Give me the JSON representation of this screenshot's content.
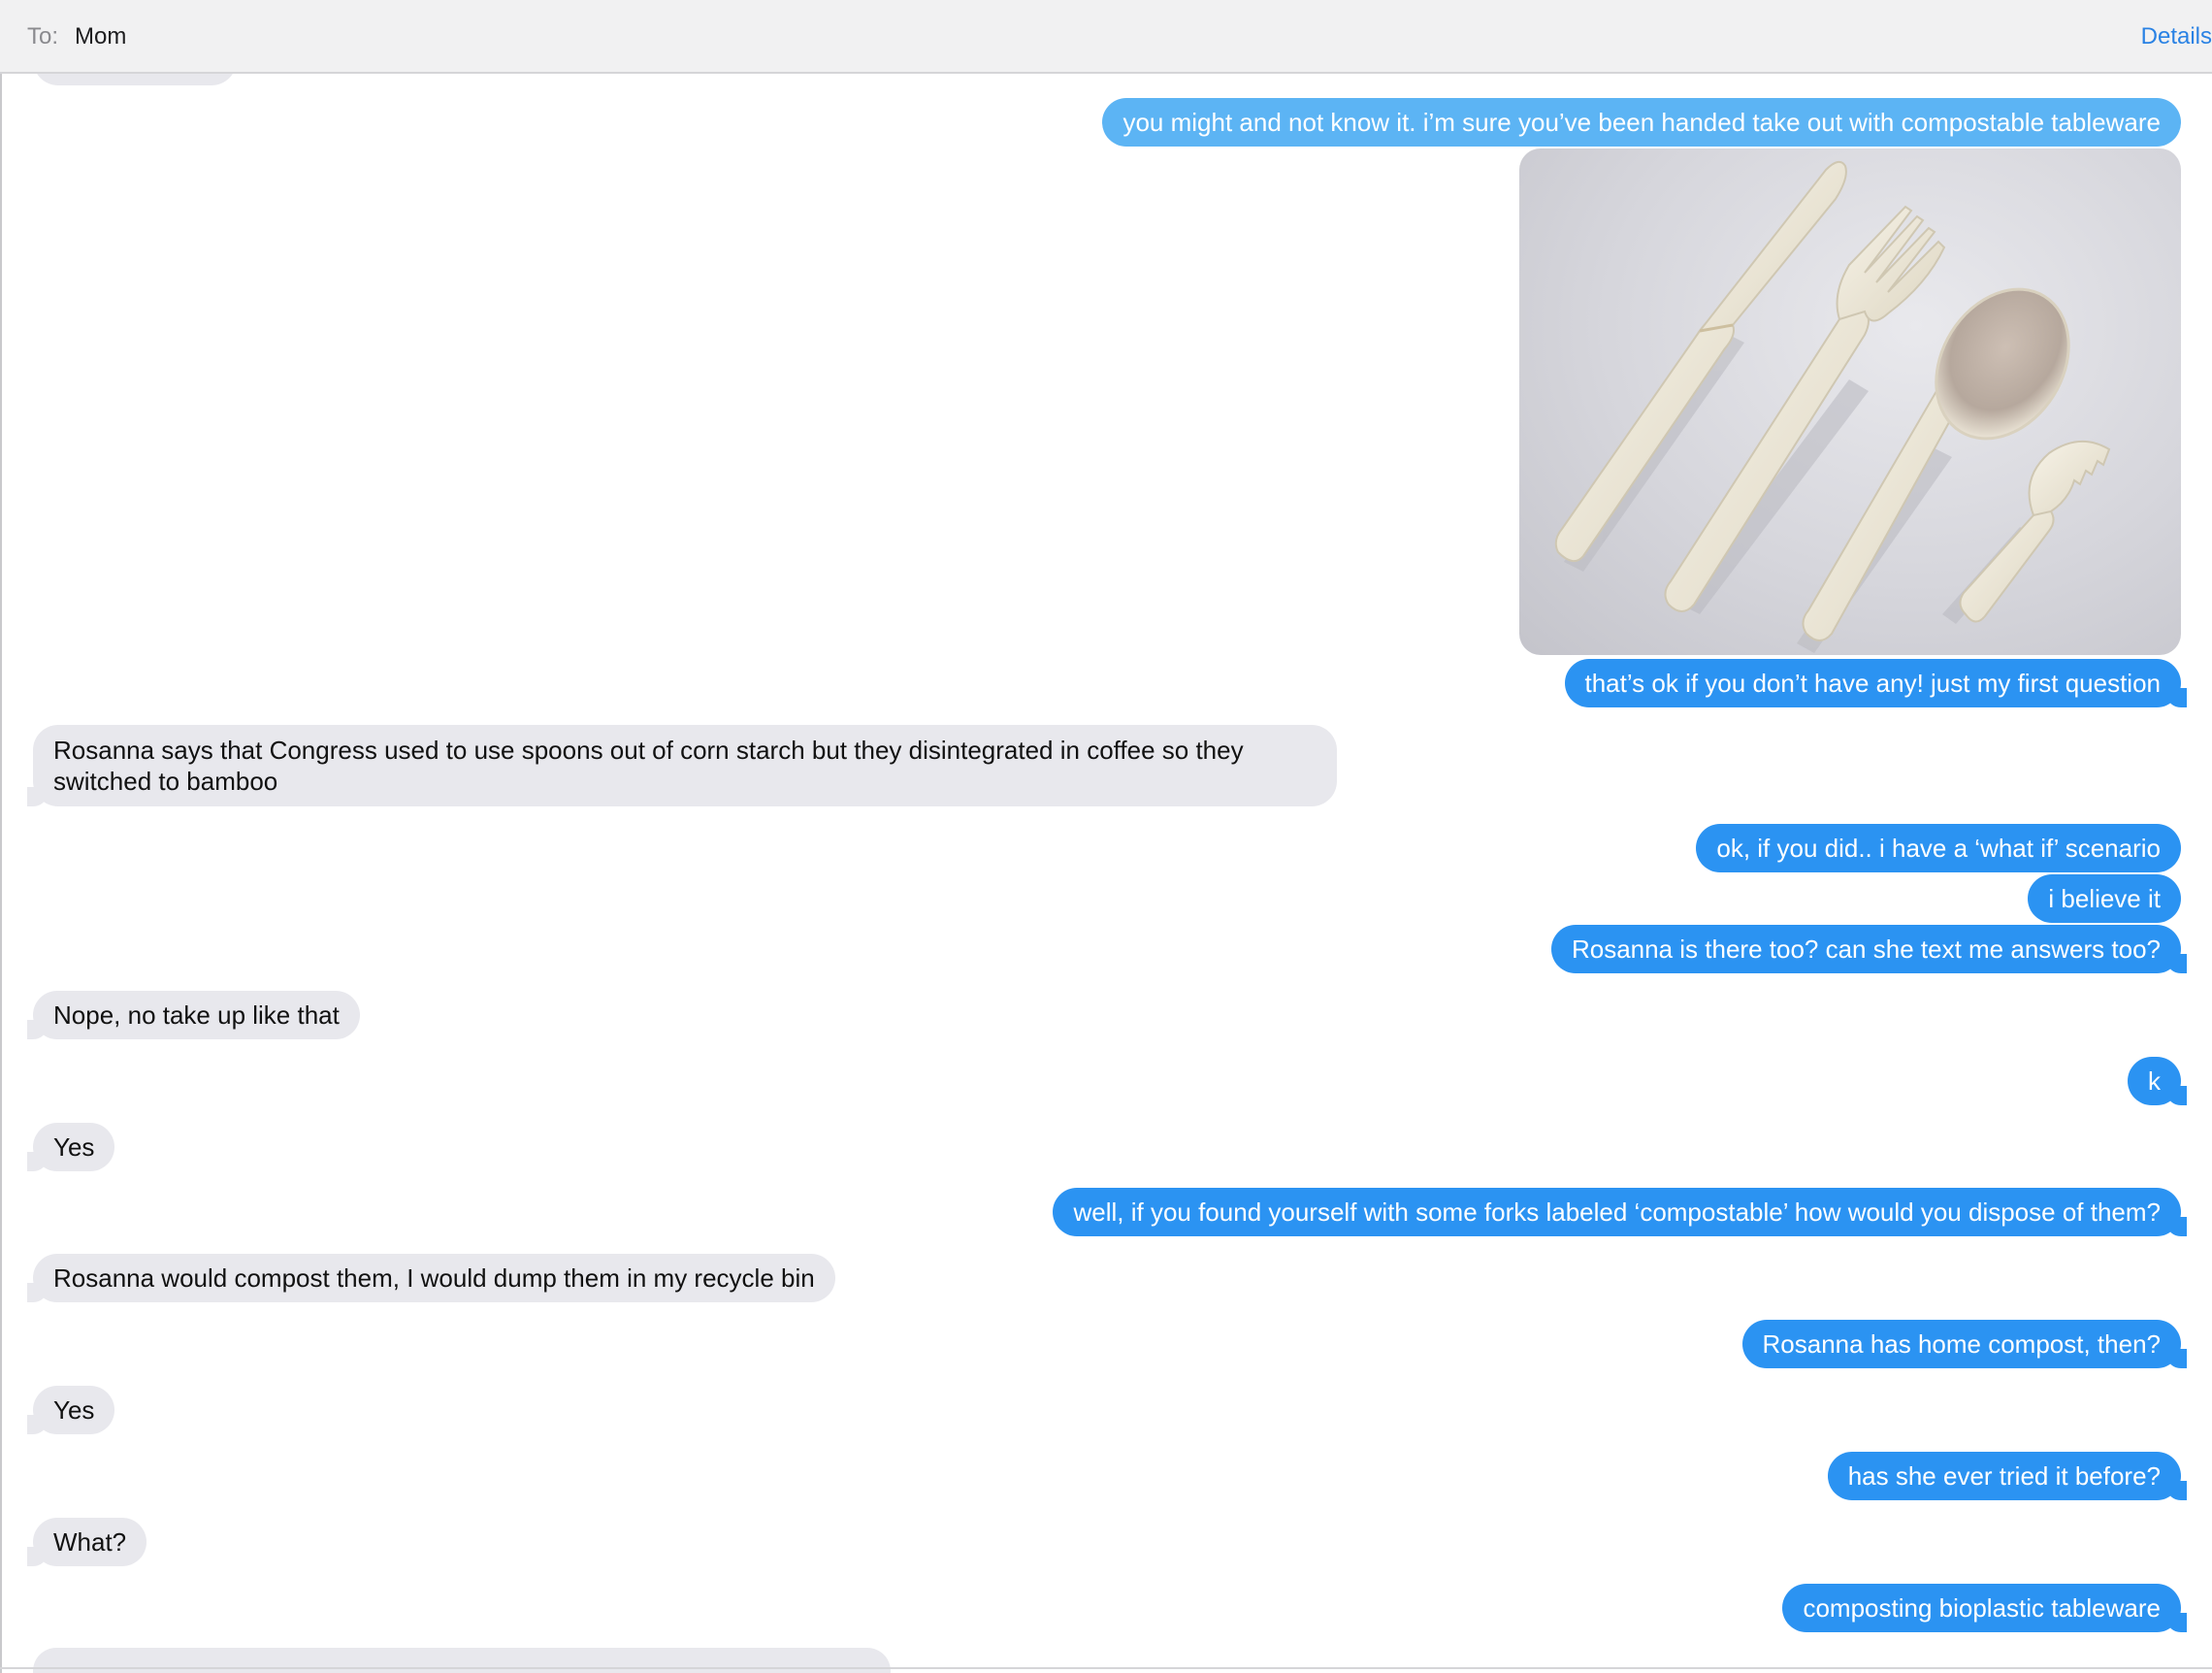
{
  "header": {
    "to_label": "To:",
    "recipient": "Mom",
    "details_label": "Details"
  },
  "colors": {
    "outgoing_bubble": "#2b93f2",
    "outgoing_bubble_faded": "#5cb4f4",
    "incoming_bubble": "#e8e8ed",
    "link_blue": "#2a82e4"
  },
  "messages": [
    {
      "from": "me",
      "text": "you might and not know it. i’m sure you’ve been handed take out with compostable tableware"
    },
    {
      "from": "me",
      "type": "image",
      "description_icon": "compostable-cutlery-photo"
    },
    {
      "from": "me",
      "text": "that’s ok if you don’t have any! just my first question"
    },
    {
      "from": "mom",
      "text": "Rosanna says that Congress used to use spoons out of corn starch but they disintegrated in coffee so they switched to bamboo"
    },
    {
      "from": "me",
      "text": "ok, if you did.. i have a ‘what if’ scenario"
    },
    {
      "from": "me",
      "text": "i believe it"
    },
    {
      "from": "me",
      "text": "Rosanna is there too? can she text me answers too?"
    },
    {
      "from": "mom",
      "text": "Nope, no take up like that"
    },
    {
      "from": "me",
      "text": "k"
    },
    {
      "from": "mom",
      "text": "Yes"
    },
    {
      "from": "me",
      "text": "well, if you found yourself with some forks labeled ‘compostable’ how would you dispose of them?"
    },
    {
      "from": "mom",
      "text": "Rosanna would compost them, I would dump them in my recycle bin"
    },
    {
      "from": "me",
      "text": "Rosanna has home compost, then?"
    },
    {
      "from": "mom",
      "text": "Yes"
    },
    {
      "from": "me",
      "text": "has she ever tried it before?"
    },
    {
      "from": "mom",
      "text": "What?"
    },
    {
      "from": "me",
      "text": "composting bioplastic tableware"
    }
  ]
}
